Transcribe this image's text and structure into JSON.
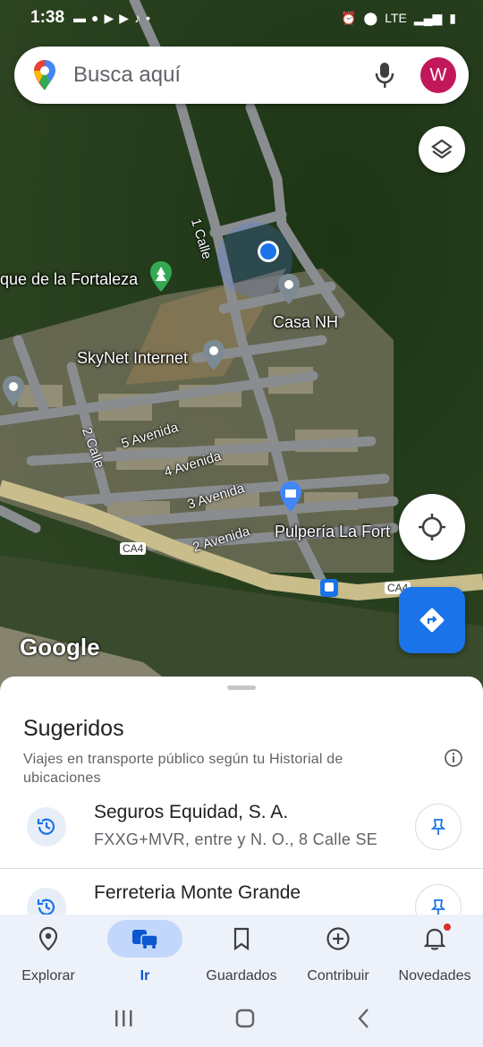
{
  "status": {
    "time": "1:38",
    "network": "LTE"
  },
  "search": {
    "placeholder": "Busca aquí",
    "avatar_letter": "W",
    "avatar_color": "#c2185b"
  },
  "map": {
    "labels": {
      "park": "que de la Fortaleza",
      "casa": "Casa NH",
      "skynet": "SkyNet Internet",
      "pulperia": "Pulpería La Fort",
      "calle1": "1 Calle",
      "calle2": "2 Calle",
      "av5": "5 Avenida",
      "av4": "4 Avenida",
      "av3": "3 Avenida",
      "av2": "2 Avenida",
      "ca4_left": "CA4",
      "ca4_right": "CA4",
      "google": "Google"
    }
  },
  "sheet": {
    "title": "Sugeridos",
    "subtitle": "Viajes en transporte público según tu Historial de ubicaciones",
    "items": [
      {
        "name": "Seguros Equidad, S. A.",
        "address": "FXXG+MVR, entre y N. O., 8 Calle SE"
      },
      {
        "name": "Ferreteria Monte Grande",
        "address": ""
      }
    ]
  },
  "nav": {
    "items": [
      {
        "label": "Explorar"
      },
      {
        "label": "Ir"
      },
      {
        "label": "Guardados"
      },
      {
        "label": "Contribuir"
      },
      {
        "label": "Novedades"
      }
    ]
  },
  "colors": {
    "accent": "#1a73e8",
    "nav_active": "#c2d7fb",
    "notification_dot": "#d93025"
  }
}
